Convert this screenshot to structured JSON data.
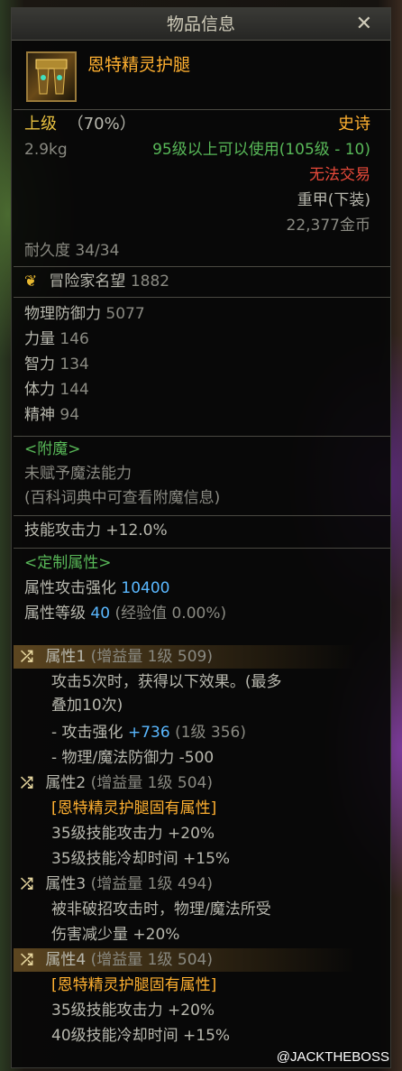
{
  "window": {
    "title": "物品信息",
    "close_symbol": "✕"
  },
  "item": {
    "name": "恩特精灵护腿",
    "grade": "上级",
    "grade_pct": "（70%）",
    "rarity": "史诗",
    "weight": "2.9kg",
    "level_req": "95级以上可以使用(105级 - 10)",
    "trade": "无法交易",
    "armor_type": "重甲(下装)",
    "price": "22,377金币",
    "durability": "耐久度 34/34",
    "fame_label": "冒险家名望",
    "fame_value": "1882"
  },
  "stats": [
    {
      "label": "物理防御力",
      "value": "5077"
    },
    {
      "label": "力量",
      "value": "146"
    },
    {
      "label": "智力",
      "value": "134"
    },
    {
      "label": "体力",
      "value": "144"
    },
    {
      "label": "精神",
      "value": "94"
    }
  ],
  "enchant": {
    "header": "<附魔>",
    "line1": "未赋予魔法能力",
    "line2": "(百科词典中可查看附魔信息)"
  },
  "skill_attack": {
    "label": "技能攻击力",
    "value": "+12.0%"
  },
  "custom": {
    "header": "<定制属性>",
    "attr_atk_label": "属性攻击强化",
    "attr_atk_value": "10400",
    "attr_lv_label": "属性等级",
    "attr_lv_value": "40",
    "attr_lv_exp": "(经验值 0.00%)"
  },
  "attributes": [
    {
      "title": "属性1",
      "meta": "(增益量 1级 509)",
      "lines": [
        "攻击5次时，获得以下效果。(最多",
        "叠加10次)"
      ],
      "sub1_label": "- 攻击强化",
      "sub1_value": "+736",
      "sub1_meta": "(1级 356)",
      "sub2": "- 物理/魔法防御力 -500"
    },
    {
      "title": "属性2",
      "meta": "(增益量 1级 504)",
      "lines": [
        "[恩特精灵护腿固有属性]",
        "35级技能攻击力 +20%",
        "35级技能冷却时间 +15%"
      ]
    },
    {
      "title": "属性3",
      "meta": "(增益量 1级 494)",
      "lines": [
        "被非破招攻击时，物理/魔法所受",
        "伤害减少量 +20%"
      ]
    },
    {
      "title": "属性4",
      "meta": "(增益量 1级 504)",
      "lines": [
        "[恩特精灵护腿固有属性]",
        "35级技能攻击力 +20%",
        "40级技能冷却时间 +15%"
      ]
    }
  ],
  "watermark": "@JACKTHEBOSS",
  "colors": {
    "rarity": "#ffb030",
    "grade": "#e8c040",
    "level_req": "#58b858",
    "trade": "#e84a3a",
    "value_blue": "#5ab8ff"
  }
}
